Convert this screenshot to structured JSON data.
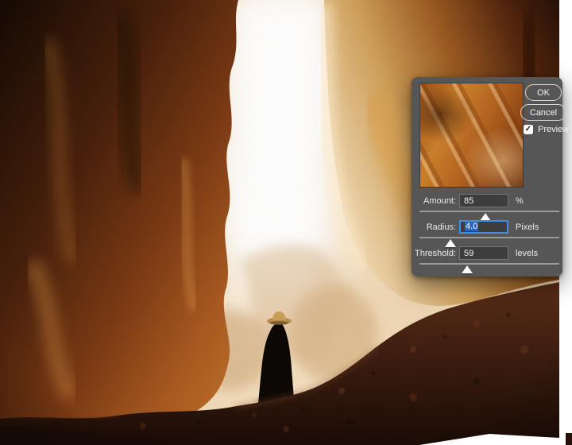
{
  "page": {
    "background": "#ffffff"
  },
  "photo": {
    "scene": "slot-canyon-with-figure"
  },
  "dialog": {
    "buttons": {
      "ok": "OK",
      "cancel": "Cancel"
    },
    "preview": {
      "label": "Preview",
      "checked": true,
      "check_glyph": "✓"
    },
    "controls": [
      {
        "id": "amount",
        "label": "Amount:",
        "value": "85",
        "unit": "%",
        "slider_percent": 47
      },
      {
        "id": "radius",
        "label": "Radius:",
        "value": "4.0",
        "unit": "Pixels",
        "slider_percent": 22,
        "focused": true
      },
      {
        "id": "threshold",
        "label": "Threshold:",
        "value": "59",
        "unit": "levels",
        "slider_percent": 34
      }
    ],
    "colors": {
      "dialog_bg": "#565656",
      "field_bg": "#3d3d3d",
      "focus_blue": "#3f8fe8",
      "selection_blue": "#2f65c0",
      "slider_track": "#9b9b9b"
    }
  }
}
